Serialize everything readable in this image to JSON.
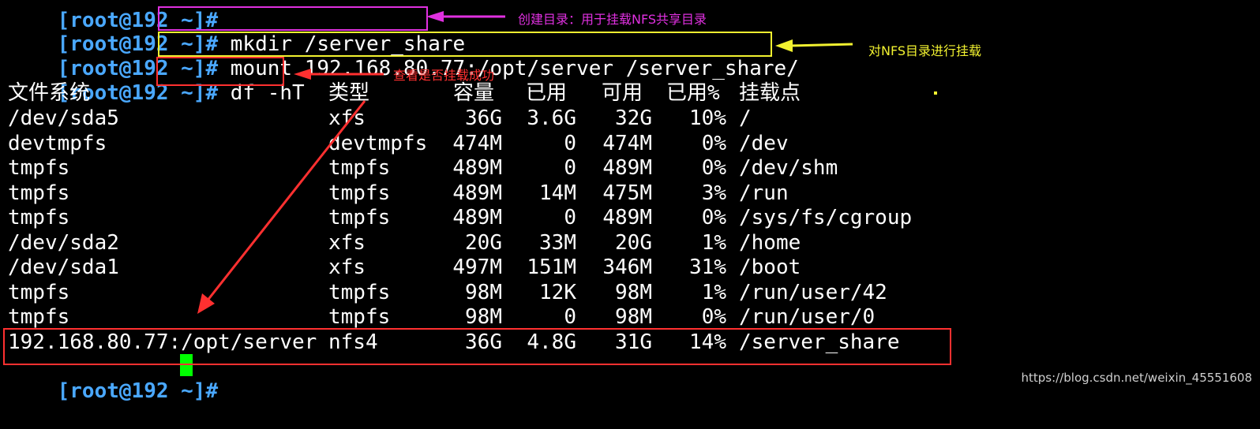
{
  "terminal": {
    "prompt": "[root@192 ~]#",
    "commands": [
      "mkdir /server_share",
      "mount 192.168.80.77:/opt/server /server_share/",
      "df -hT"
    ],
    "df_headers": [
      "文件系统",
      "类型",
      "容量",
      "已用",
      "可用",
      "已用%",
      "挂载点"
    ],
    "df_rows": [
      [
        "/dev/sda5",
        "xfs",
        "36G",
        "3.6G",
        "32G",
        "10%",
        "/"
      ],
      [
        "devtmpfs",
        "devtmpfs",
        "474M",
        "0",
        "474M",
        "0%",
        "/dev"
      ],
      [
        "tmpfs",
        "tmpfs",
        "489M",
        "0",
        "489M",
        "0%",
        "/dev/shm"
      ],
      [
        "tmpfs",
        "tmpfs",
        "489M",
        "14M",
        "475M",
        "3%",
        "/run"
      ],
      [
        "tmpfs",
        "tmpfs",
        "489M",
        "0",
        "489M",
        "0%",
        "/sys/fs/cgroup"
      ],
      [
        "/dev/sda2",
        "xfs",
        "20G",
        "33M",
        "20G",
        "1%",
        "/home"
      ],
      [
        "/dev/sda1",
        "xfs",
        "497M",
        "151M",
        "346M",
        "31%",
        "/boot"
      ],
      [
        "tmpfs",
        "tmpfs",
        "98M",
        "12K",
        "98M",
        "1%",
        "/run/user/42"
      ],
      [
        "tmpfs",
        "tmpfs",
        "98M",
        "0",
        "98M",
        "0%",
        "/run/user/0"
      ],
      [
        "192.168.80.77:/opt/server",
        "nfs4",
        "36G",
        "4.8G",
        "31G",
        "14%",
        "/server_share"
      ]
    ]
  },
  "annotations": {
    "mkdir_note": "创建目录：用于挂载NFS共享目录",
    "mount_note": "对NFS目录进行挂载",
    "df_note": "查看是否挂载成功"
  },
  "watermark": "https://blog.csdn.net/weixin_45551608",
  "colors": {
    "prompt": "#4aa8ff",
    "cursor": "#00ff00",
    "mkdir_annotation": "#e030e0",
    "mount_annotation": "#f2f230",
    "df_annotation": "#ff3030"
  }
}
